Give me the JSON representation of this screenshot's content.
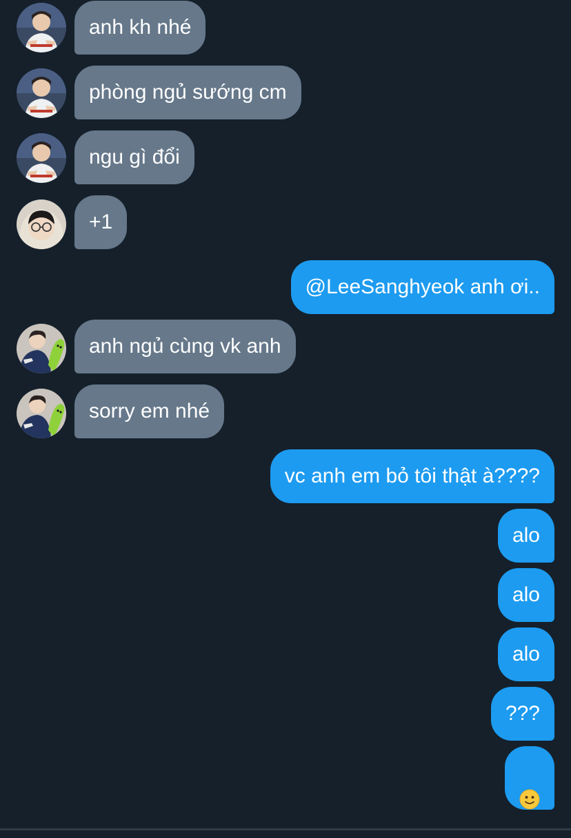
{
  "colors": {
    "background": "#15202b",
    "incoming_bubble": "#66788a",
    "outgoing_bubble": "#1d9bf0",
    "text": "#ffffff"
  },
  "messages": [
    {
      "direction": "in",
      "sender_avatar": "avatar-boy-blue-shirt",
      "text": "anh kh nhé"
    },
    {
      "direction": "in",
      "sender_avatar": "avatar-boy-blue-shirt",
      "text": "phòng ngủ sướng cm"
    },
    {
      "direction": "in",
      "sender_avatar": "avatar-boy-blue-shirt",
      "text": "ngu gì đổi"
    },
    {
      "direction": "in",
      "sender_avatar": "avatar-glasses-hood",
      "text": "+1"
    },
    {
      "direction": "out",
      "text": "@LeeSanghyeok anh ơi.."
    },
    {
      "direction": "in",
      "sender_avatar": "avatar-green-plush",
      "text": "anh ngủ cùng vk anh"
    },
    {
      "direction": "in",
      "sender_avatar": "avatar-green-plush",
      "text": "sorry em nhé"
    },
    {
      "direction": "out",
      "text": "vc anh em bỏ tôi thật à????"
    },
    {
      "direction": "out",
      "text": "alo"
    },
    {
      "direction": "out",
      "text": "alo"
    },
    {
      "direction": "out",
      "text": "alo"
    },
    {
      "direction": "out",
      "text": "???"
    },
    {
      "direction": "out",
      "emoji": "slightly-smiling-face-emoji"
    }
  ]
}
